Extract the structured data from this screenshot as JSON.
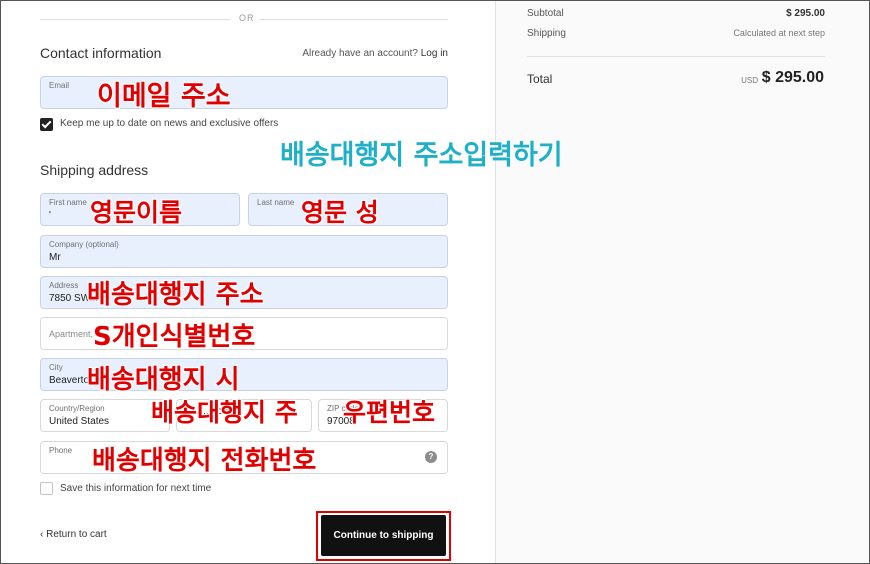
{
  "divider": {
    "or": "OR"
  },
  "contact": {
    "title": "Contact information",
    "have_account": "Already have an account?",
    "login": "Log in",
    "email_label": "Email",
    "marketing_label": "Keep me up to date on news and exclusive offers"
  },
  "shipping": {
    "title": "Shipping address",
    "first_name_label": "First name",
    "first_name_value": "'",
    "last_name_label": "Last name",
    "company_label": "Company (optional)",
    "company_value": "Mr",
    "address_label": "Address",
    "address_value": "7850 SW...",
    "apartment_placeholder": "Apartment, s...",
    "city_label": "City",
    "city_value": "Beaverto...",
    "country_label": "Country/Region",
    "country_value": "United States",
    "state_value": "...gon",
    "zip_label": "ZIP code",
    "zip_value": "97008",
    "phone_label": "Phone",
    "help_icon_text": "?",
    "save_label": "Save this information for next time"
  },
  "footer": {
    "return_arrow": "‹",
    "return_label": "Return to cart",
    "continue_label": "Continue to shipping"
  },
  "summary": {
    "subtotal_label": "Subtotal",
    "subtotal_value": "$ 295.00",
    "shipping_label": "Shipping",
    "shipping_value": "Calculated at next step",
    "total_label": "Total",
    "total_currency": "USD",
    "total_value": "$ 295.00"
  },
  "annotations": {
    "email": "이메일 주소",
    "header": "배송대행지 주소입력하기",
    "first_name": "영문이름",
    "last_name": "영문 성",
    "address": "배송대행지 주소",
    "apartment": "S개인식별번호",
    "city": "배송대행지 시",
    "state": "배송대행지 주",
    "zip": "우편번호",
    "phone": "배송대행지 전화번호"
  },
  "colors": {
    "annotation_red": "#e00000",
    "annotation_blue": "#1fb0c8",
    "autofill_field": "#e8f0fe",
    "button": "#111111"
  }
}
